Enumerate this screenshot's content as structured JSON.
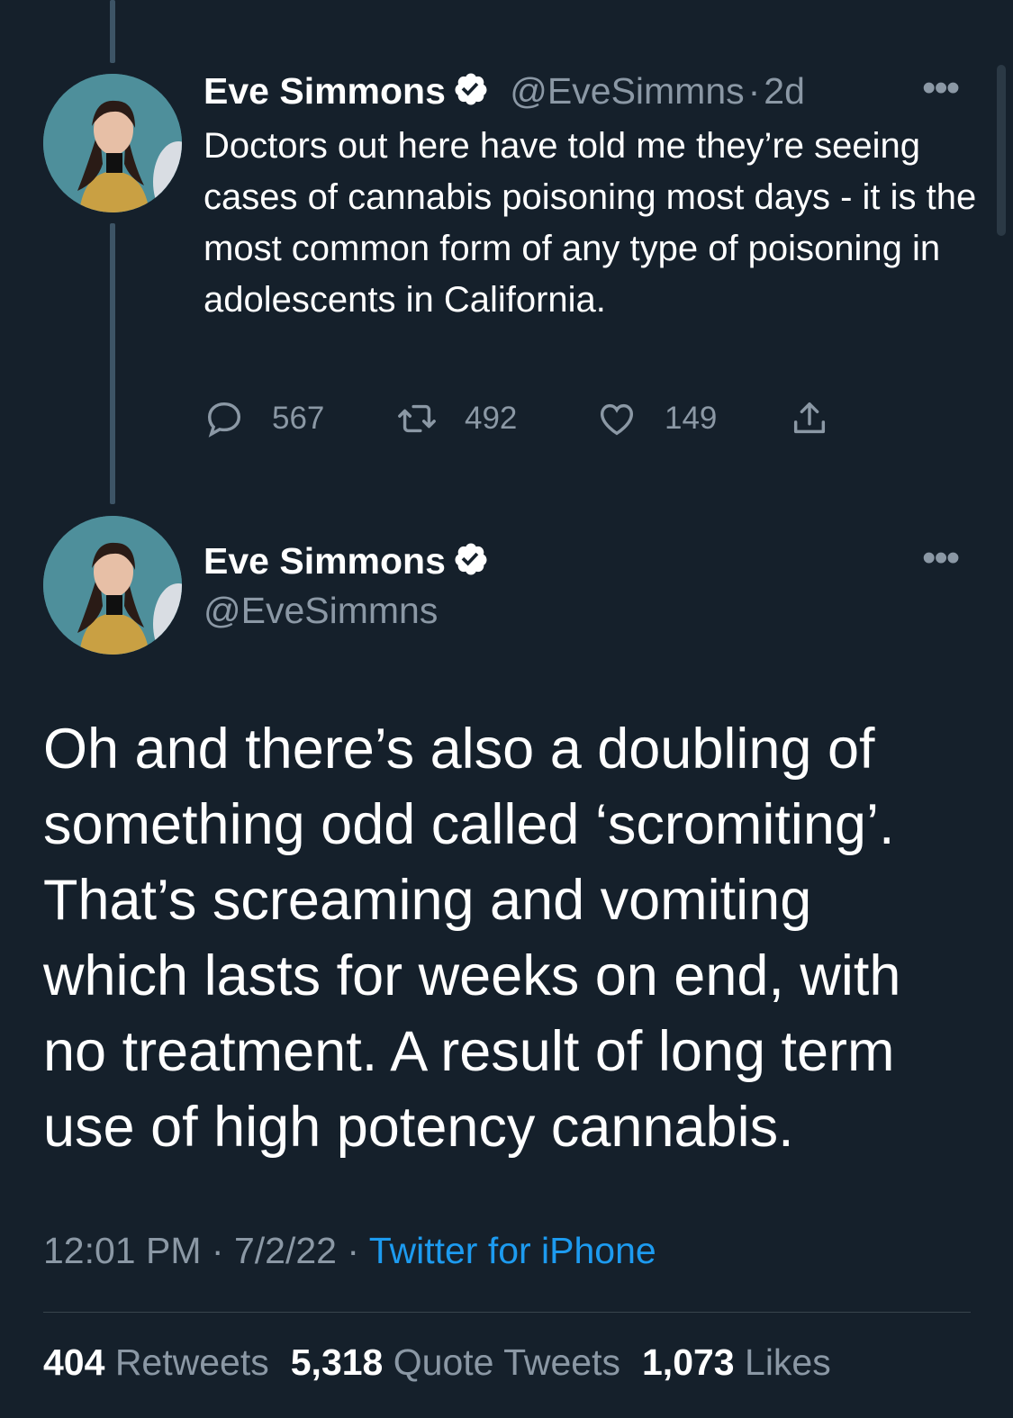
{
  "thread_parent": {
    "author_name": "Eve Simmons",
    "handle": "@EveSimmns",
    "separator": "·",
    "time": "2d",
    "text": "Doctors out here have told me they’re seeing cases of cannabis poisoning most days - it is the most common form of any type of poisoning in adolescents in California.",
    "replies": "567",
    "retweets": "492",
    "likes": "149"
  },
  "main_tweet": {
    "author_name": "Eve Simmons",
    "handle": "@EveSimmns",
    "text": "Oh and there’s also a doubling of something odd called ‘scromiting’. That’s screaming and vomiting which lasts for weeks on end, with no treatment. A result of long term use of high potency cannabis.",
    "time": "12:01 PM",
    "date": "7/2/22",
    "separator": "·",
    "source": "Twitter for iPhone",
    "stats": {
      "retweets_count": "404",
      "retweets_label": "Retweets",
      "quotes_count": "5,318",
      "quotes_label": "Quote Tweets",
      "likes_count": "1,073",
      "likes_label": "Likes"
    }
  },
  "colors": {
    "background": "#15202b",
    "secondary_text": "#8b98a5",
    "link": "#1d9bf0",
    "verified_badge": "#ffffff"
  },
  "icons": [
    "verified-icon",
    "more-icon",
    "reply-icon",
    "retweet-icon",
    "like-icon",
    "share-icon"
  ]
}
